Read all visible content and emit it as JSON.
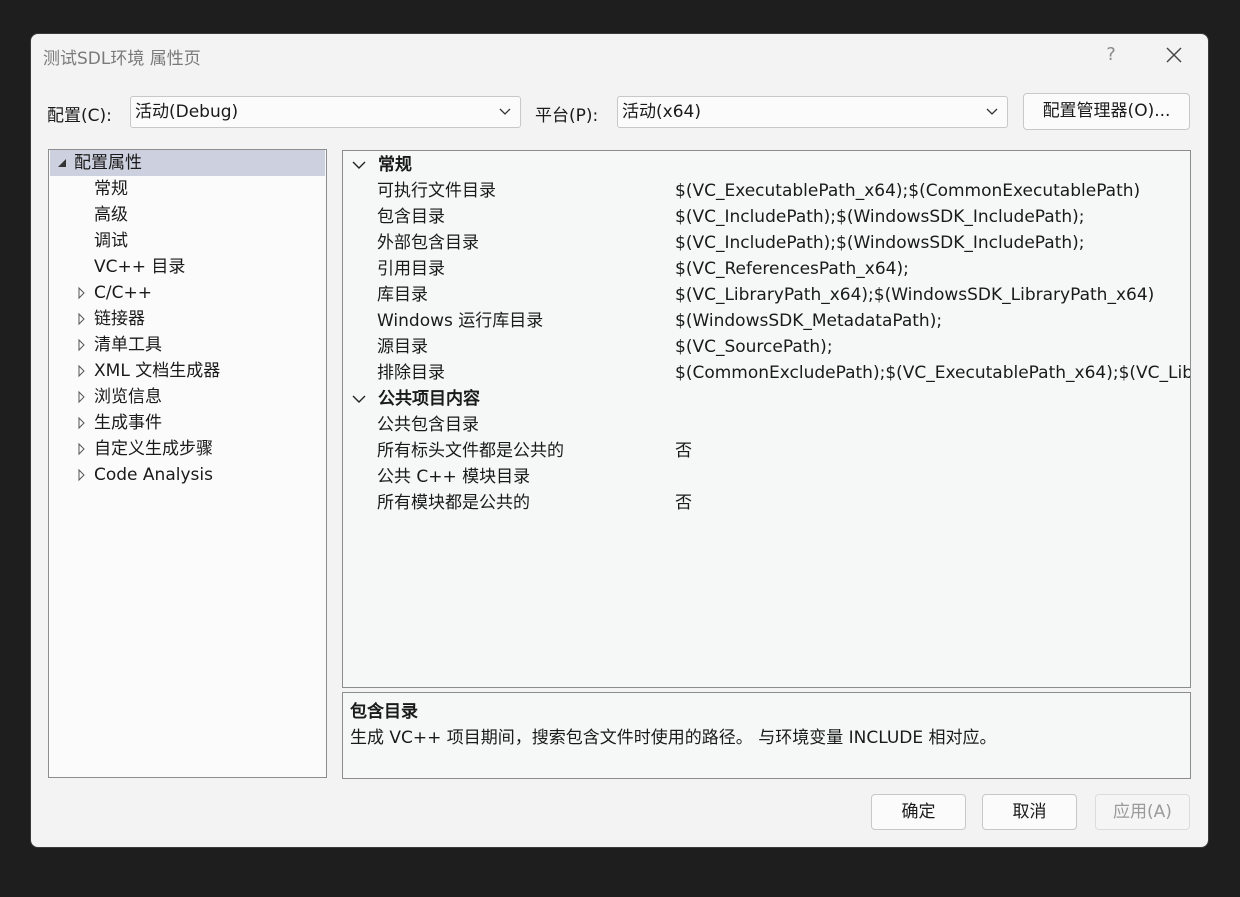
{
  "window": {
    "title": "测试SDL环境 属性页",
    "help_label": "?"
  },
  "config_bar": {
    "config_label": "配置(C):",
    "config_value": "活动(Debug)",
    "platform_label": "平台(P):",
    "platform_value": "活动(x64)",
    "manager_button": "配置管理器(O)..."
  },
  "tree": {
    "root": {
      "label": "配置属性",
      "expanded": true,
      "selected": true
    },
    "items": [
      {
        "label": "常规",
        "expandable": false
      },
      {
        "label": "高级",
        "expandable": false
      },
      {
        "label": "调试",
        "expandable": false
      },
      {
        "label": "VC++ 目录",
        "expandable": false
      },
      {
        "label": "C/C++",
        "expandable": true
      },
      {
        "label": "链接器",
        "expandable": true
      },
      {
        "label": "清单工具",
        "expandable": true
      },
      {
        "label": "XML 文档生成器",
        "expandable": true
      },
      {
        "label": "浏览信息",
        "expandable": true
      },
      {
        "label": "生成事件",
        "expandable": true
      },
      {
        "label": "自定义生成步骤",
        "expandable": true
      },
      {
        "label": "Code Analysis",
        "expandable": true
      }
    ]
  },
  "grid": {
    "sections": [
      {
        "label": "常规",
        "rows": [
          {
            "name": "可执行文件目录",
            "value": "$(VC_ExecutablePath_x64);$(CommonExecutablePath)"
          },
          {
            "name": "包含目录",
            "value": "$(VC_IncludePath);$(WindowsSDK_IncludePath);"
          },
          {
            "name": "外部包含目录",
            "value": "$(VC_IncludePath);$(WindowsSDK_IncludePath);"
          },
          {
            "name": "引用目录",
            "value": "$(VC_ReferencesPath_x64);"
          },
          {
            "name": "库目录",
            "value": "$(VC_LibraryPath_x64);$(WindowsSDK_LibraryPath_x64)"
          },
          {
            "name": "Windows 运行库目录",
            "value": "$(WindowsSDK_MetadataPath);"
          },
          {
            "name": "源目录",
            "value": "$(VC_SourcePath);"
          },
          {
            "name": "排除目录",
            "value": "$(CommonExcludePath);$(VC_ExecutablePath_x64);$(VC_Lib"
          }
        ]
      },
      {
        "label": "公共项目内容",
        "rows": [
          {
            "name": "公共包含目录",
            "value": ""
          },
          {
            "name": "所有标头文件都是公共的",
            "value": "否"
          },
          {
            "name": "公共 C++ 模块目录",
            "value": ""
          },
          {
            "name": "所有模块都是公共的",
            "value": "否"
          }
        ]
      }
    ]
  },
  "description": {
    "title": "包含目录",
    "text": "生成 VC++ 项目期间，搜索包含文件时使用的路径。 与环境变量 INCLUDE 相对应。"
  },
  "buttons": {
    "ok": "确定",
    "cancel": "取消",
    "apply": "应用(A)"
  },
  "colors": {
    "selection": "#cdd1df",
    "dialog_bg": "#f3f3f3",
    "outer_bg": "#1e1e1e"
  }
}
